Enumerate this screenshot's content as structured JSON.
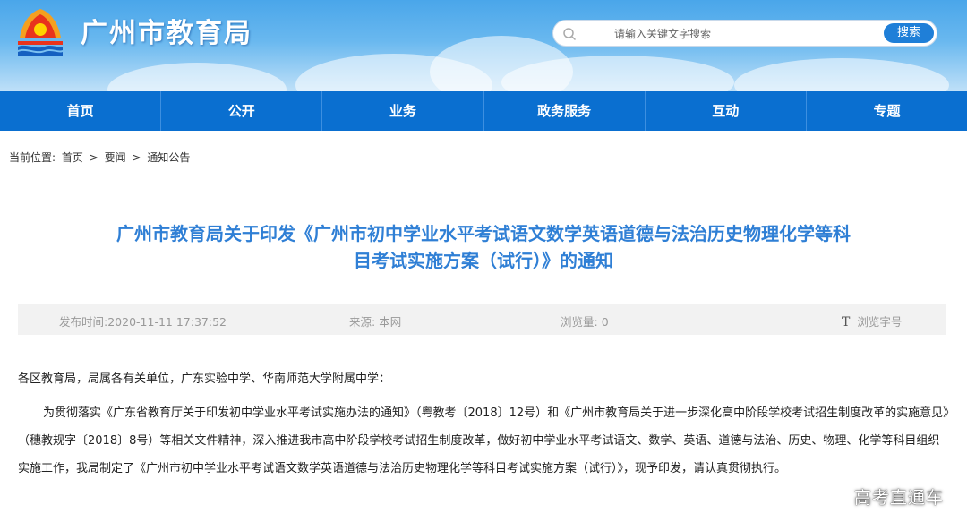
{
  "header": {
    "site_title": "广州市教育局",
    "search": {
      "placeholder": "请输入关键文字搜索",
      "button": "搜索"
    }
  },
  "nav": {
    "items": [
      "首页",
      "公开",
      "业务",
      "政务服务",
      "互动",
      "专题"
    ]
  },
  "breadcrumb": {
    "prefix": "当前位置:",
    "items": [
      "首页",
      "要闻",
      "通知公告"
    ],
    "separator": ">"
  },
  "article": {
    "title_line1": "广州市教育局关于印发《广州市初中学业水平考试语文数学英语道德与法治历史物理化学等科",
    "title_line2": "目考试实施方案（试行）》的通知",
    "meta": {
      "publish_label": "发布时间:",
      "publish_value": "2020-11-11 17:37:52",
      "source_label": "来源:",
      "source_value": "本网",
      "views_label": "浏览量:",
      "views_value": "0",
      "font_icon": "T",
      "font_label": "浏览字号"
    },
    "salutation": "各区教育局，局属各有关单位，广东实验中学、华南师范大学附属中学：",
    "paragraph": "为贯彻落实《广东省教育厅关于印发初中学业水平考试实施办法的通知》（粤教考〔2018〕12号）和《广州市教育局关于进一步深化高中阶段学校考试招生制度改革的实施意见》（穗教规字〔2018〕8号）等相关文件精神，深入推进我市高中阶段学校考试招生制度改革，做好初中学业水平考试语文、数学、英语、道德与法治、历史、物理、化学等科目组织实施工作，我局制定了《广州市初中学业水平考试语文数学英语道德与法治历史物理化学等科目考试实施方案（试行）》，现予印发，请认真贯彻执行。"
  },
  "watermark": "高考直通车"
}
